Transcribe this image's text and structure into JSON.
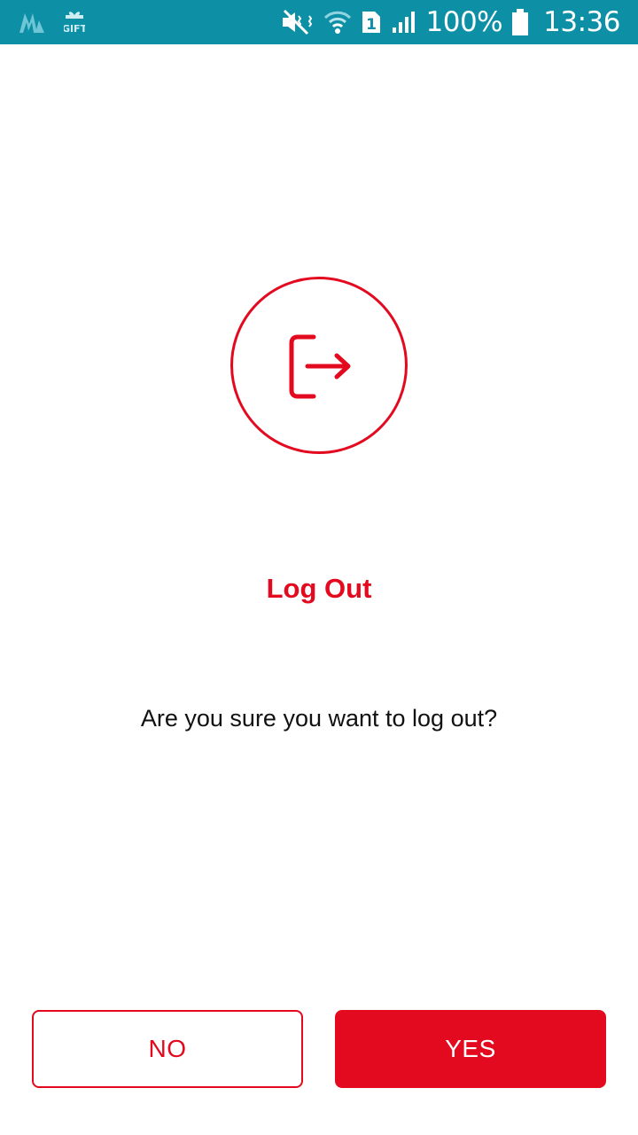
{
  "status_bar": {
    "battery": "100%",
    "time": "13:36",
    "sim_slot": "1",
    "notification_icons": [
      "app-notification-icon",
      "gift-icon"
    ],
    "system_icons": [
      "vibrate-mute-icon",
      "wifi-icon",
      "sim-icon",
      "signal-icon",
      "battery-icon"
    ]
  },
  "dialog": {
    "icon": "logout-icon",
    "title": "Log Out",
    "message": "Are you sure you want to log out?",
    "no_label": "NO",
    "yes_label": "YES"
  },
  "colors": {
    "accent": "#e30a1f",
    "status_bar": "#0d8fa6",
    "background": "#ffffff",
    "text": "#111111"
  }
}
